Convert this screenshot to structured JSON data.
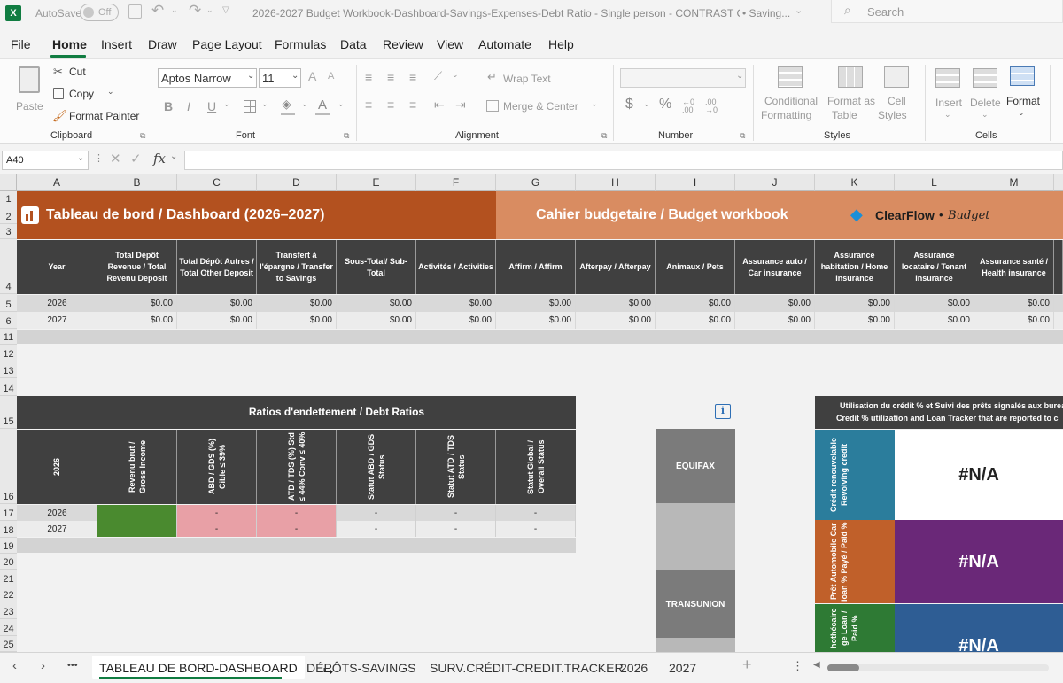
{
  "title_bar": {
    "autosave_label": "AutoSave",
    "autosave_state": "Off",
    "document_title": "2026-2027 Budget Workbook-Dashboard-Savings-Expenses-Debt Ratio - Single person - CONTRAST CO...",
    "save_status": "• Saving...",
    "search_placeholder": "Search"
  },
  "menu": {
    "items": [
      "File",
      "Home",
      "Insert",
      "Draw",
      "Page Layout",
      "Formulas",
      "Data",
      "Review",
      "View",
      "Automate",
      "Help"
    ],
    "active": "Home"
  },
  "ribbon": {
    "clipboard": {
      "paste": "Paste",
      "cut": "Cut",
      "copy": "Copy",
      "format_painter": "Format Painter",
      "label": "Clipboard"
    },
    "font": {
      "name": "Aptos Narrow",
      "size": "11",
      "label": "Font",
      "bold": "B",
      "italic": "I",
      "underline": "U",
      "font_color_glyph": "A"
    },
    "alignment": {
      "wrap_text": "Wrap Text",
      "merge_center": "Merge & Center",
      "label": "Alignment"
    },
    "number": {
      "format": "",
      "label": "Number",
      "currency": "$",
      "percent": "%"
    },
    "styles": {
      "conditional": "Conditional",
      "formatting": "Formatting",
      "format_as": "Format as",
      "table": "Table",
      "cell": "Cell",
      "styles_word": "Styles",
      "label": "Styles"
    },
    "cells": {
      "insert": "Insert",
      "delete": "Delete",
      "format": "Format",
      "label": "Cells"
    }
  },
  "formula_bar": {
    "name_box": "A40",
    "fx": "fx",
    "content": ""
  },
  "columns": [
    "A",
    "B",
    "C",
    "D",
    "E",
    "F",
    "G",
    "H",
    "I",
    "J",
    "K",
    "L",
    "M"
  ],
  "rows": [
    "1",
    "2",
    "3",
    "4",
    "5",
    "6",
    "11",
    "12",
    "13",
    "14",
    "15",
    "16",
    "17",
    "18",
    "19",
    "20",
    "21",
    "22",
    "23",
    "24",
    "25"
  ],
  "dashboard": {
    "title": "Tableau de bord / Dashboard  (2026–2027)",
    "workbook_title": "Cahier budgetaire  / Budget workbook",
    "logo_text": "ClearFlow",
    "logo_sub": "Budget",
    "headers": [
      "Year",
      "Total Dépôt Revenue / Total Revenu Deposit",
      "Total Dépôt Autres / Total Other Deposit",
      "Transfert à l'épargne / Transfer to Savings",
      "Sous-Total/ Sub-Total",
      "Activités / Activities",
      "Affirm / Affirm",
      "Afterpay / Afterpay",
      "Animaux / Pets",
      "Assurance auto / Car insurance",
      "Assurance habitation / Home insurance",
      "Assurance locataire / Tenant insurance",
      "Assurance santé / Health insurance"
    ],
    "rows": [
      {
        "year": "2026",
        "values": [
          "$0.00",
          "$0.00",
          "$0.00",
          "$0.00",
          "$0.00",
          "$0.00",
          "$0.00",
          "$0.00",
          "$0.00",
          "$0.00",
          "$0.00",
          "$0.00"
        ]
      },
      {
        "year": "2027",
        "values": [
          "$0.00",
          "$0.00",
          "$0.00",
          "$0.00",
          "$0.00",
          "$0.00",
          "$0.00",
          "$0.00",
          "$0.00",
          "$0.00",
          "$0.00",
          "$0.00"
        ]
      }
    ]
  },
  "debt_ratios": {
    "title": "Ratios d'endettement / Debt Ratios",
    "year_header": "2026",
    "headers": [
      "Revenu brut / Gross Income",
      "ABD / GDS (%) Cible ≤ 39%",
      "ATD / TDS (%) Std ≤ 44% Conv ≤ 40%",
      "Statut ABD / GDS Status",
      "Statut ATD / TDS Status",
      "Statut Global / Overall Status"
    ],
    "rows": [
      {
        "year": "2026",
        "values": [
          "",
          "-",
          "-",
          "-",
          "-",
          "-"
        ]
      },
      {
        "year": "2027",
        "values": [
          "",
          "-",
          "-",
          "-",
          "-",
          "-"
        ]
      }
    ]
  },
  "bureaus": {
    "info_icon": "i",
    "equifax": "EQUIFAX",
    "transunion": "TRANSUNION"
  },
  "credit_tracker": {
    "header_line1": "Utilisation du crédit %  et Suivi des prêts signalés aux burea",
    "header_line2": "Credit % utilization and  Loan Tracker that are reported to c",
    "items": [
      {
        "label": "Crédit renouvelable Revolving credit",
        "value": "#N/A"
      },
      {
        "label": "Prêt Automobile Car loan % Payé / Paid %",
        "value": "#N/A"
      },
      {
        "label": "hothécaire ge Loan / Paid %",
        "value": "#N/A"
      }
    ]
  },
  "sheet_tabs": {
    "tabs": [
      "TABLEAU DE BORD-DASHBOARD",
      "DÉPÔTS-SAVINGS",
      "SURV.CRÉDIT-CREDIT.TRACKER",
      "2026",
      "2027"
    ],
    "active": "TABLEAU DE BORD-DASHBOARD",
    "more": "•••",
    "add": "+"
  },
  "colors": {
    "title_orange": "#b3511f",
    "title_salmon": "#d98c61",
    "header_dark": "#404040",
    "green_cell": "#4a8a2f",
    "pink_cell": "#e8a0a6",
    "teal": "#2b7d9c",
    "rust": "#c0602a",
    "purple": "#6a2878",
    "green_dark": "#2e7a34",
    "blue": "#2e5d94"
  }
}
